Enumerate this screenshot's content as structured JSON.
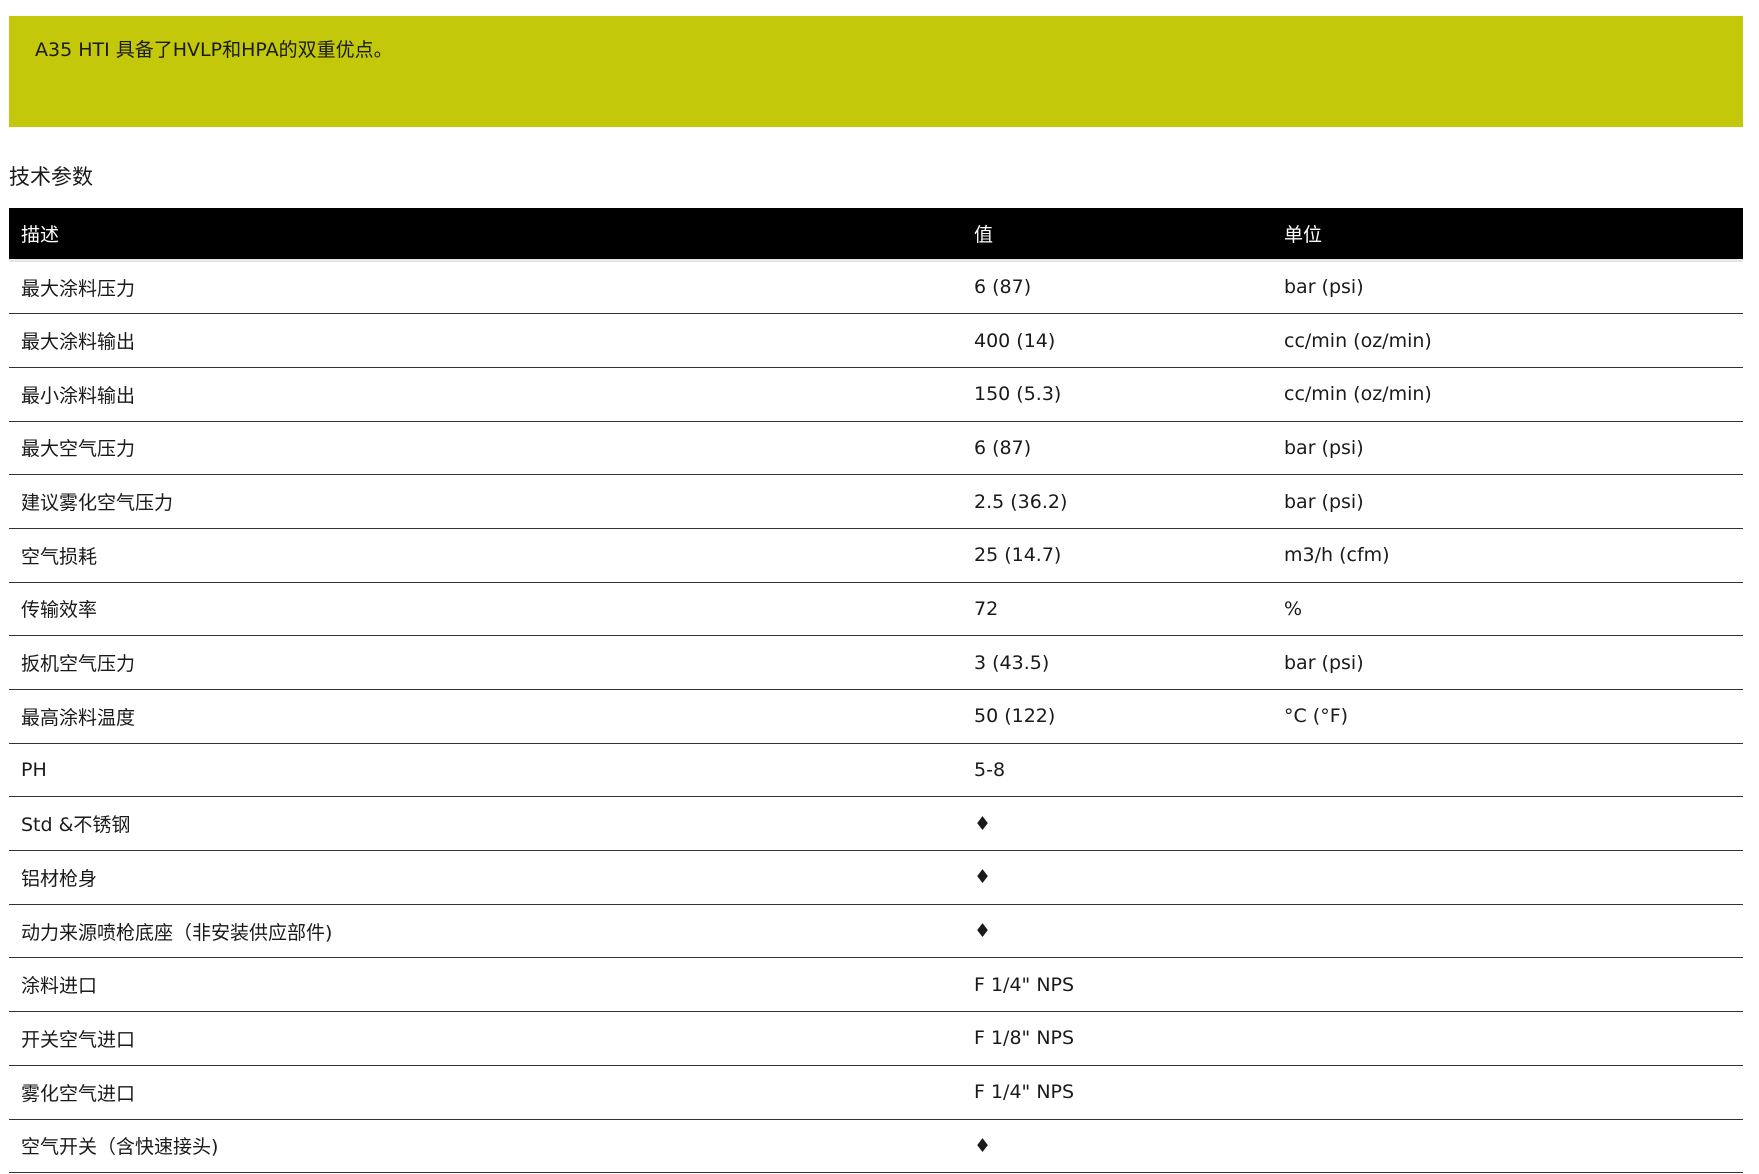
{
  "banner": {
    "text": "A35 HTI 具备了HVLP和HPA的双重优点。",
    "color": "#c3c90a"
  },
  "section_title": "技术参数",
  "table": {
    "headers": [
      "描述",
      "值",
      "单位"
    ],
    "rows": [
      [
        "最大涂料压力",
        "6 (87)",
        "bar (psi)"
      ],
      [
        "最大涂料输出",
        "400 (14)",
        "cc/min (oz/min)"
      ],
      [
        "最小涂料输出",
        "150 (5.3)",
        "cc/min (oz/min)"
      ],
      [
        "最大空气压力",
        "6 (87)",
        "bar (psi)"
      ],
      [
        "建议雾化空气压力",
        "2.5 (36.2)",
        "bar (psi)"
      ],
      [
        "空气损耗",
        "25 (14.7)",
        "m3/h (cfm)"
      ],
      [
        "传输效率",
        "72",
        "%"
      ],
      [
        "扳机空气压力",
        "3 (43.5)",
        "bar (psi)"
      ],
      [
        "最高涂料温度",
        "50 (122)",
        "°C (°F)"
      ],
      [
        "PH",
        "5-8",
        ""
      ],
      [
        "Std &不锈钢",
        "♦",
        ""
      ],
      [
        "铝材枪身",
        "♦",
        ""
      ],
      [
        "动力来源喷枪底座（非安装供应部件)",
        "♦",
        ""
      ],
      [
        "涂料进口",
        "F 1/4\" NPS",
        ""
      ],
      [
        "开关空气进口",
        "F 1/8\" NPS",
        ""
      ],
      [
        "雾化空气进口",
        "F 1/4\" NPS",
        ""
      ],
      [
        "空气开关（含快速接头)",
        "♦",
        ""
      ]
    ]
  }
}
